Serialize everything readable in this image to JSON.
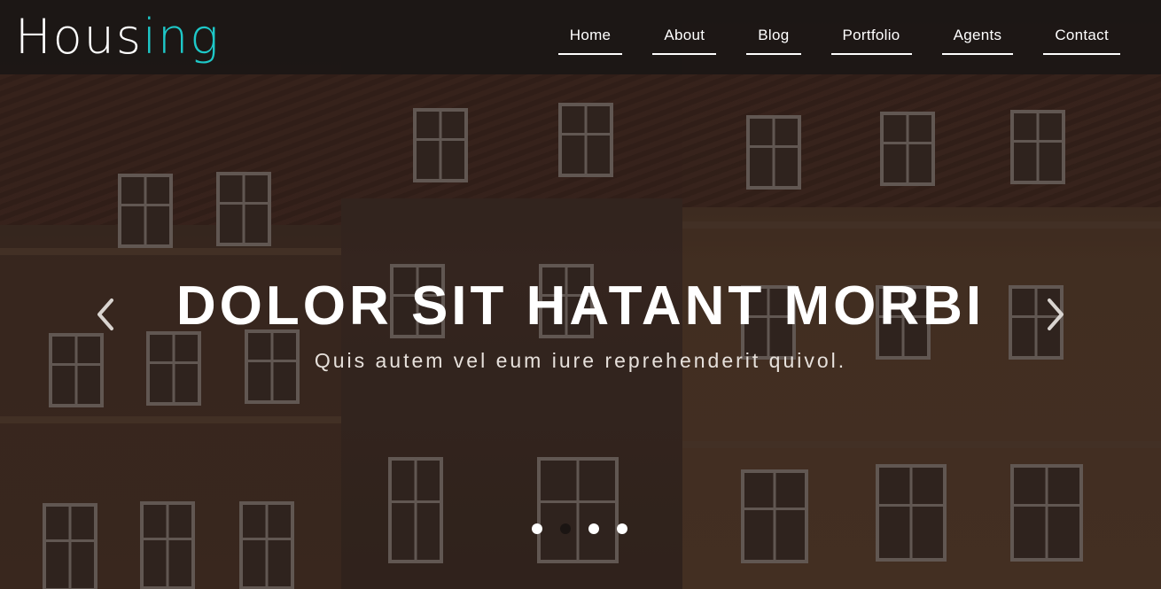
{
  "brand": {
    "logo_main": "Hous",
    "logo_accent": "ing",
    "accent_color": "#1ec8c8"
  },
  "nav": {
    "items": [
      {
        "label": "Home"
      },
      {
        "label": "About"
      },
      {
        "label": "Blog"
      },
      {
        "label": "Portfolio"
      },
      {
        "label": "Agents"
      },
      {
        "label": "Contact"
      }
    ]
  },
  "hero": {
    "headline": "DOLOR SIT HATANT MORBI",
    "subline": "Quis autem vel eum iure reprehenderit quivol.",
    "prev_icon": "chevron-left-icon",
    "next_icon": "chevron-right-icon",
    "slide_count": 4,
    "active_slide": 2
  }
}
